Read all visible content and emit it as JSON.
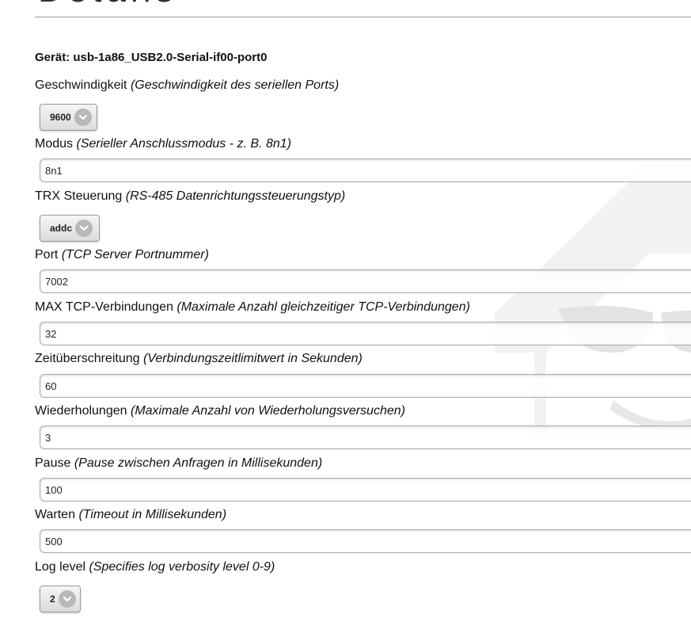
{
  "page": {
    "heading": "Details",
    "device_title": "Gerät: usb-1a86_USB2.0-Serial-if00-port0"
  },
  "fields": {
    "speed": {
      "label": "Geschwindigkeit",
      "hint": "(Geschwindigkeit des seriellen Ports)",
      "value": "9600"
    },
    "mode": {
      "label": "Modus",
      "hint": "(Serieller Anschlussmodus - z. B. 8n1)",
      "value": "8n1"
    },
    "trx": {
      "label": "TRX Steuerung",
      "hint": "(RS-485 Datenrichtungssteuerungstyp)",
      "value": "addc"
    },
    "port": {
      "label": "Port",
      "hint": "(TCP Server Portnummer)",
      "value": "7002"
    },
    "max_tcp": {
      "label": "MAX TCP-Verbindungen",
      "hint": "(Maximale Anzahl gleichzeitiger TCP-Verbindungen)",
      "value": "32"
    },
    "timeout": {
      "label": "Zeitüberschreitung",
      "hint": "(Verbindungszeitlimitwert in Sekunden)",
      "value": "60"
    },
    "retries": {
      "label": "Wiederholungen",
      "hint": "(Maximale Anzahl von Wiederholungsversuchen)",
      "value": "3"
    },
    "pause": {
      "label": "Pause",
      "hint": "(Pause zwischen Anfragen in Millisekunden)",
      "value": "100"
    },
    "wait": {
      "label": "Warten",
      "hint": "(Timeout in Millisekunden)",
      "value": "500"
    },
    "log_level": {
      "label": "Log level",
      "hint": "(Specifies log verbosity level 0-9)",
      "value": "2"
    }
  },
  "icons": {
    "select_chevron": "chevron-down-icon",
    "watermark": "house-logo-icon"
  },
  "colors": {
    "border": "#aaaaaa",
    "watermark": "#e6e6e6",
    "chevron_circle": "#b8b8b8"
  }
}
